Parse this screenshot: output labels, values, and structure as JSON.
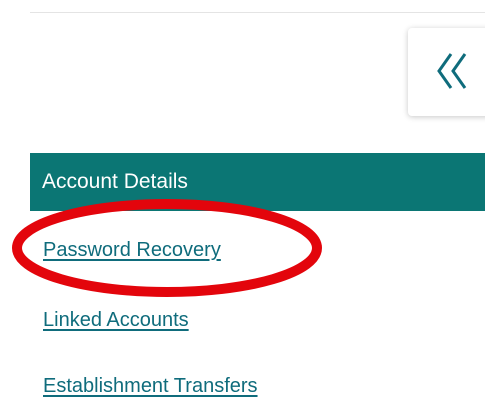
{
  "collapse_button": {
    "icon": "double-chevron-left-icon"
  },
  "nav": {
    "section_header": "Account Details",
    "links": [
      {
        "label": "Password Recovery"
      },
      {
        "label": "Linked Accounts"
      },
      {
        "label": "Establishment Transfers"
      }
    ]
  },
  "colors": {
    "header_bg": "#0b7674",
    "link": "#0f6c7c",
    "annotation": "#e3050c"
  }
}
